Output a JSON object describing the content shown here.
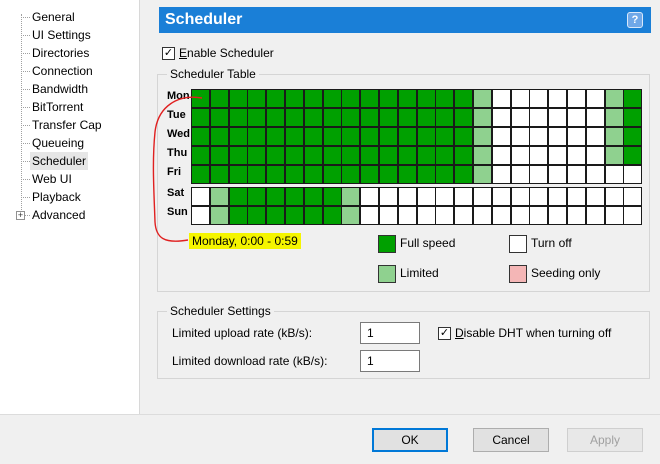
{
  "sidebar": {
    "items": [
      {
        "label": "General"
      },
      {
        "label": "UI Settings"
      },
      {
        "label": "Directories"
      },
      {
        "label": "Connection"
      },
      {
        "label": "Bandwidth"
      },
      {
        "label": "BitTorrent"
      },
      {
        "label": "Transfer Cap"
      },
      {
        "label": "Queueing"
      },
      {
        "label": "Scheduler",
        "selected": true
      },
      {
        "label": "Web UI"
      },
      {
        "label": "Playback"
      },
      {
        "label": "Advanced",
        "expander": "+"
      }
    ]
  },
  "header": {
    "title": "Scheduler",
    "help_icon": "?"
  },
  "enable_scheduler": {
    "label_first": "E",
    "label_rest": "nable Scheduler",
    "checked": true,
    "check_glyph": "✓"
  },
  "scheduler_table": {
    "title": "Scheduler Table",
    "days": [
      "Mon",
      "Tue",
      "Wed",
      "Thu",
      "Fri",
      "Sat",
      "Sun"
    ],
    "rows": [
      "FFFFFFFFFFFFFFFLOOOOOOLF",
      "FFFFFFFFFFFFFFFLOOOOOOLF",
      "FFFFFFFFFFFFFFFLOOOOOOLF",
      "FFFFFFFFFFFFFFFLOOOOOOLF",
      "FFFFFFFFFFFFFFFLOOOOOOOO",
      "OLFFFFFFLOOOOOOOOOOOOOOO",
      "OLFFFFFFLOOOOOOOOOOOOOOO"
    ],
    "hover_label": "Monday, 0:00 - 0:59",
    "legend": {
      "full": "Full speed",
      "limited": "Limited",
      "off": "Turn off",
      "seeding": "Seeding only"
    },
    "colors": {
      "full": "#00a000",
      "limited": "#8fd18f",
      "off": "#ffffff",
      "seeding": "#f4b6b6",
      "highlight": "#f5f500",
      "annotation": "#e02020"
    }
  },
  "scheduler_settings": {
    "title": "Scheduler Settings",
    "upload_label": "Limited upload rate (kB/s):",
    "upload_value": "1",
    "download_label": "Limited download rate (kB/s):",
    "download_value": "1",
    "dht_label_first": "D",
    "dht_label_rest": "isable DHT when turning off",
    "dht_checked": true,
    "check_glyph": "✓"
  },
  "buttons": {
    "ok": "OK",
    "cancel": "Cancel",
    "apply": "Apply"
  }
}
